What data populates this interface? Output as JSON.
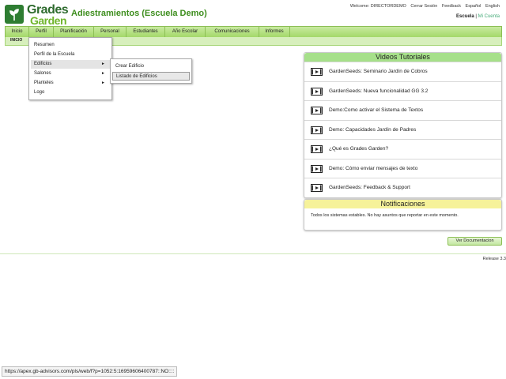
{
  "logo": {
    "line1": "Grades",
    "line2": "Garden"
  },
  "app_title": "Adiestramientos (Escuela Demo)",
  "top_links": [
    "Welcome: DIRECTORDEMO",
    "Cerrar Sesión",
    "Feedback",
    "Español",
    "English"
  ],
  "user_links": {
    "school": "Escuela",
    "separator": "|",
    "account": "Mi Cuenta"
  },
  "nav": [
    "Inicio",
    "Perfil",
    "Planificación",
    "Personal",
    "Estudiantes",
    "Año Escolar",
    "Comunicaciones",
    "Informes"
  ],
  "breadcrumb": "INICIO",
  "perfil_menu": [
    "Resumen",
    "Perfil de la Escuela",
    "Edificios",
    "Salones",
    "Planteles",
    "Logo"
  ],
  "submenu_arrow": "►",
  "edificios_menu": [
    "Crear Edificio",
    "Listado de Edificios"
  ],
  "videos": {
    "title": "Videos Tutoriales",
    "items": [
      "GardenSeeds: Seminario Jardín de Cobros",
      "GardenSeeds: Nueva funcionalidad GG 3.2",
      "Demo:Como activar el Sistema de Textos",
      "Demo: Capacidades Jardín de Padres",
      "¿Qué es Grades Garden?",
      "Demo: Cómo enviar mensajes de texto",
      "GardenSeeds: Feedback & Support"
    ]
  },
  "notifications": {
    "title": "Notificaciones",
    "message": "Todos los sistemas estables. No hay asuntos que reportar en este momento."
  },
  "ver_doc": "Ver Documentacion",
  "release": "Release 3.3",
  "status_url": "https://apex.gb-advisors.com/pls/web/f?p=1052:5:16959606400787::NO::::",
  "colors": {
    "accent_green": "#3e8e1e",
    "nav_green": "#a4d86a",
    "videos_header": "#a6e08a",
    "notif_header": "#f6f29a"
  }
}
